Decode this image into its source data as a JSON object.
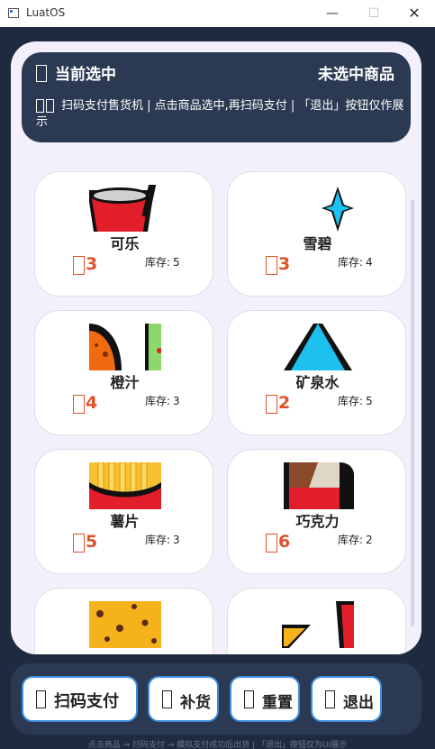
{
  "window": {
    "title": "LuatOS",
    "minimize": "—",
    "maximize": "☐",
    "close": "✕"
  },
  "header": {
    "selected_label": "当前选中",
    "selected_value": "未选中商品",
    "info_text": "扫码支付售货机 | 点击商品选中,再扫码支付 | 「退出」按钮仅作展示"
  },
  "products": [
    {
      "name": "可乐",
      "price": "3",
      "stock_label": "库存:",
      "stock": "5",
      "icon": "cola-cup-icon"
    },
    {
      "name": "雪碧",
      "price": "3",
      "stock_label": "库存:",
      "stock": "4",
      "icon": "sparkle-icon"
    },
    {
      "name": "橙汁",
      "price": "4",
      "stock_label": "库存:",
      "stock": "3",
      "icon": "orange-juice-icon"
    },
    {
      "name": "矿泉水",
      "price": "2",
      "stock_label": "库存:",
      "stock": "5",
      "icon": "water-drop-icon"
    },
    {
      "name": "薯片",
      "price": "5",
      "stock_label": "库存:",
      "stock": "3",
      "icon": "french-fries-icon"
    },
    {
      "name": "巧克力",
      "price": "6",
      "stock_label": "库存:",
      "stock": "2",
      "icon": "chocolate-bar-icon"
    },
    {
      "name": "",
      "price": "",
      "stock_label": "",
      "stock": "",
      "icon": "cookie-icon"
    },
    {
      "name": "",
      "price": "",
      "stock_label": "",
      "stock": "",
      "icon": "drink-combo-icon"
    }
  ],
  "buttons": {
    "scan_pay": "扫码支付",
    "restock": "补货",
    "reset": "重置",
    "quit": "退出"
  },
  "hint": "点击商品 → 扫码支付 → 模拟支付成功后出货 | 「退出」按钮仅为UI展示",
  "colors": {
    "panel_bg": "#f3f0fb",
    "header_bg": "#2b3a52",
    "price": "#e0522a",
    "button_border": "#3a8fe0"
  }
}
